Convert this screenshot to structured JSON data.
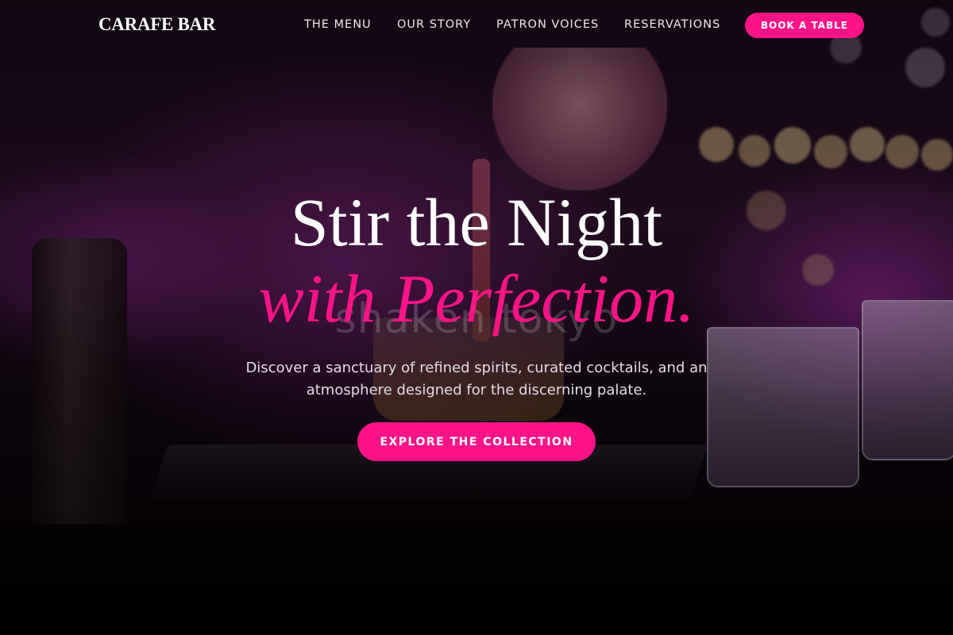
{
  "brand": {
    "logo": "CARAFE BAR"
  },
  "nav": {
    "links": [
      "THE MENU",
      "OUR STORY",
      "PATRON VOICES",
      "RESERVATIONS"
    ],
    "cta_label": "BOOK A TABLE"
  },
  "hero": {
    "headline_line1": "Stir the Night",
    "headline_line2": "with Perfection.",
    "subtext": "Discover a sanctuary of refined spirits, curated cocktails, and an atmosphere designed for the discerning palate.",
    "cta_label": "EXPLORE THE COLLECTION",
    "background_watermark": "shaken tokyo"
  },
  "colors": {
    "accent": "#ff1487",
    "text": "#ffffff",
    "subtext": "#e6dce6"
  },
  "icons": []
}
